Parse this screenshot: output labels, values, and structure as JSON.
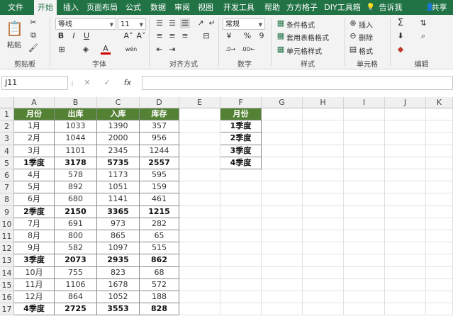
{
  "tabs": [
    "文件",
    "开始",
    "插入",
    "页面布局",
    "公式",
    "数据",
    "审阅",
    "视图",
    "开发工具",
    "帮助",
    "方方格子",
    "DIY工具箱",
    "告诉我",
    "共享"
  ],
  "active_tab": "开始",
  "ribbon": {
    "paste": "粘贴",
    "font_name": "等线",
    "font_size": "11",
    "bold": "B",
    "italic": "I",
    "underline": "U",
    "grow_font": "A˄",
    "shrink_font": "A˅",
    "font_color": "A",
    "phonetic": "wén",
    "number_format": "常规",
    "percent": "%",
    "comma": "9",
    "currency": "¥",
    "conditional_format": "条件格式",
    "table_format": "套用表格格式",
    "cell_style": "单元格样式",
    "insert": "插入",
    "delete": "删除",
    "format": "格式",
    "groups": [
      "剪贴板",
      "字体",
      "对齐方式",
      "数字",
      "样式",
      "单元格",
      "编辑"
    ]
  },
  "formula_bar": {
    "name_box": "J11",
    "fx": "fx",
    "cancel": "✕",
    "confirm": "✓",
    "formula": ""
  },
  "columns": [
    "A",
    "B",
    "C",
    "D",
    "E",
    "F",
    "G",
    "H",
    "I",
    "J",
    "K"
  ],
  "row_numbers": [
    "1",
    "2",
    "3",
    "4",
    "5",
    "6",
    "7",
    "8",
    "9",
    "10",
    "11",
    "12",
    "13",
    "14",
    "15",
    "16",
    "17"
  ],
  "table_headers": [
    "月份",
    "出库",
    "入库",
    "库存"
  ],
  "table_rows": [
    [
      "1月",
      "1033",
      "1390",
      "357"
    ],
    [
      "2月",
      "1044",
      "2000",
      "956"
    ],
    [
      "3月",
      "1101",
      "2345",
      "1244"
    ],
    [
      "1季度",
      "3178",
      "5735",
      "2557"
    ],
    [
      "4月",
      "578",
      "1173",
      "595"
    ],
    [
      "5月",
      "892",
      "1051",
      "159"
    ],
    [
      "6月",
      "680",
      "1141",
      "461"
    ],
    [
      "2季度",
      "2150",
      "3365",
      "1215"
    ],
    [
      "7月",
      "691",
      "973",
      "282"
    ],
    [
      "8月",
      "800",
      "865",
      "65"
    ],
    [
      "9月",
      "582",
      "1097",
      "515"
    ],
    [
      "3季度",
      "2073",
      "2935",
      "862"
    ],
    [
      "10月",
      "755",
      "823",
      "68"
    ],
    [
      "11月",
      "1106",
      "1678",
      "572"
    ],
    [
      "12月",
      "864",
      "1052",
      "188"
    ],
    [
      "4季度",
      "2725",
      "3553",
      "828"
    ]
  ],
  "summary_rows": [
    3,
    7,
    11,
    15
  ],
  "lookup": {
    "header": "月份",
    "items": [
      "1季度",
      "2季度",
      "3季度",
      "4季度"
    ]
  }
}
